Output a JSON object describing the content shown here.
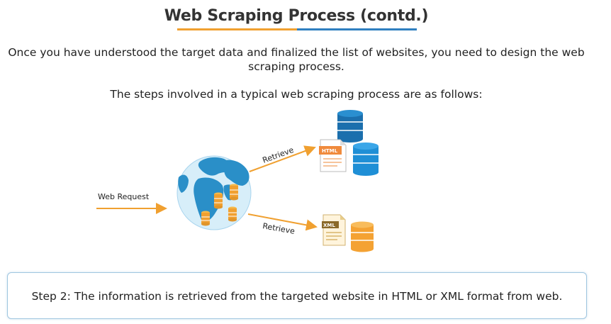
{
  "slide": {
    "title": "Web Scraping Process (contd.)",
    "intro": "Once you have understood the target data and finalized the list of websites, you need to design the web scraping process.",
    "steps_heading": "The steps involved in a typical web scraping process are as follows:"
  },
  "diagram": {
    "web_request_label": "Web Request",
    "retrieve_top_label": "Retrieve",
    "retrieve_bottom_label": "Retrieve",
    "html_doc_label": "HTML",
    "xml_doc_label": "XML",
    "colors": {
      "arrow": "#f0a030",
      "database_blue": "#1f8fd6",
      "database_dark_blue": "#1b6fad",
      "database_orange": "#f4a233",
      "ocean": "#d7eef9",
      "land": "#2a8fc8",
      "coin": "#f0a030"
    }
  },
  "step": {
    "text": "Step 2: The information is retrieved from the targeted website in HTML or XML format from web."
  }
}
